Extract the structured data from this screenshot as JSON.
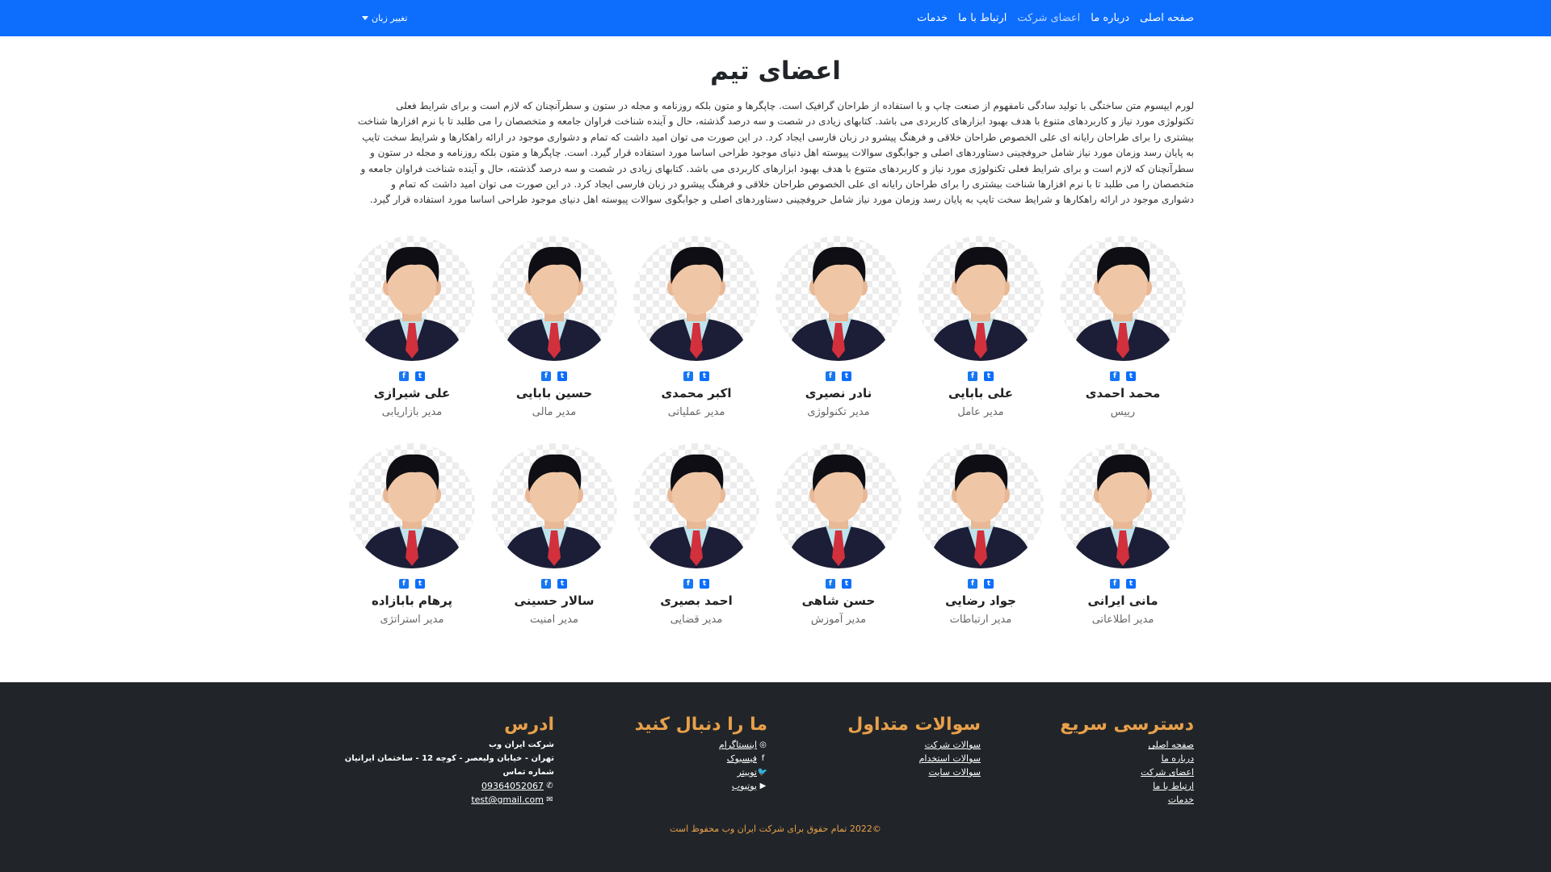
{
  "navbar": {
    "language_button": "تغییر زبان",
    "links": [
      {
        "label": "صفحه اصلی",
        "muted": false
      },
      {
        "label": "درباره ما",
        "muted": false
      },
      {
        "label": "اعضای شرکت",
        "muted": true
      },
      {
        "label": "ارتباط با ما",
        "muted": false
      },
      {
        "label": "خدمات",
        "muted": false
      }
    ],
    "color": "#0d6efd"
  },
  "main": {
    "title": "اعضای تیم",
    "intro": "لورم ایپسوم متن ساختگی با تولید سادگی نامفهوم از صنعت چاپ و با استفاده از طراحان گرافیک است. چاپگرها و متون بلکه روزنامه و مجله در ستون و سطرآنچنان که لازم است و برای شرایط فعلی تکنولوژی مورد نیاز و کاربردهای متنوع با هدف بهبود ابزارهای کاربردی می باشد. کتابهای زیادی در شصت و سه درصد گذشته، حال و آینده شناخت فراوان جامعه و متخصصان را می طلبد تا با نرم افزارها شناخت بیشتری را برای طراحان رایانه ای علی الخصوص طراحان خلاقی و فرهنگ پیشرو در زبان فارسی ایجاد کرد. در این صورت می توان امید داشت که تمام و دشواری موجود در ارائه راهکارها و شرایط سخت تایپ به پایان رسد وزمان مورد نیاز شامل حروفچینی دستاوردهای اصلی و جوابگوی سوالات پیوسته اهل دنیای موجود طراحی اساسا مورد استفاده قرار گیرد. است. چاپگرها و متون بلکه روزنامه و مجله در ستون و سطرآنچنان که لازم است و برای شرایط فعلی تکنولوژی مورد نیاز و کاربردهای متنوع با هدف بهبود ابزارهای کاربردی می باشد. کتابهای زیادی در شصت و سه درصد گذشته، حال و آینده شناخت فراوان جامعه و متخصصان را می طلبد تا با نرم افزارها شناخت بیشتری را برای طراحان رایانه ای علی الخصوص طراحان خلاقی و فرهنگ پیشرو در زبان فارسی ایجاد کرد. در این صورت می توان امید داشت که تمام و دشواری موجود در ارائه راهکارها و شرایط سخت تایپ به پایان رسد وزمان مورد نیاز شامل حروفچینی دستاوردهای اصلی و جوابگوی سوالات پیوسته اهل دنیای موجود طراحی اساسا مورد استفاده قرار گیرد.",
    "members": [
      {
        "name": "محمد احمدی",
        "role": "رییس"
      },
      {
        "name": "علی بابایی",
        "role": "مدیر عامل"
      },
      {
        "name": "نادر نصیری",
        "role": "مدیر تکنولوژی"
      },
      {
        "name": "اکبر محمدی",
        "role": "مدیر عملیاتی"
      },
      {
        "name": "حسین بابایی",
        "role": "مدیر مالی"
      },
      {
        "name": "علی شیرازی",
        "role": "مدیر بازاریابی"
      },
      {
        "name": "مانی ایرانی",
        "role": "مدیر اطلاعاتی"
      },
      {
        "name": "جواد رضایی",
        "role": "مدیر ارتباطات"
      },
      {
        "name": "حسن شاهی",
        "role": "مدیر آموزش"
      },
      {
        "name": "احمد بصیری",
        "role": "مدیر قضایی"
      },
      {
        "name": "سالار حسینی",
        "role": "مدیر امنیت"
      },
      {
        "name": "پرهام بابازاده",
        "role": "مدیر استراتژی"
      }
    ],
    "member_icons": [
      "facebook-icon",
      "twitter-icon"
    ]
  },
  "footer": {
    "quick_access": {
      "title": "دسترسی سریع",
      "links": [
        "صفحه اصلی",
        "درباره ما",
        "اعضای شرکت",
        "ارتباط با ما",
        "خدمات"
      ]
    },
    "faq": {
      "title": "سوالات متداول",
      "links": [
        "سوالات شرکت",
        "سوالات استخدام",
        "سوالات سایت"
      ]
    },
    "follow": {
      "title": "ما را دنبال کنید",
      "links": [
        {
          "label": "اینستاگرام",
          "icon": "instagram-icon"
        },
        {
          "label": "فیسبوک",
          "icon": "facebook-icon"
        },
        {
          "label": "توییتر",
          "icon": "twitter-icon"
        },
        {
          "label": "یوتیوب",
          "icon": "youtube-icon"
        }
      ]
    },
    "address": {
      "title": "ادرس",
      "company": "شرکت ایران وب",
      "street": "تهران - خیابان ولیعصر - کوچه 12 - ساختمان ایرانیان",
      "phone_label": "شماره تماس",
      "phone": "09364052067",
      "email": "test@gmail.com"
    },
    "copyright": "©2022 تمام حقوق برای شرکت ایران وب محفوظ است",
    "accent_color": "#e8a04a",
    "background": "#212529"
  }
}
